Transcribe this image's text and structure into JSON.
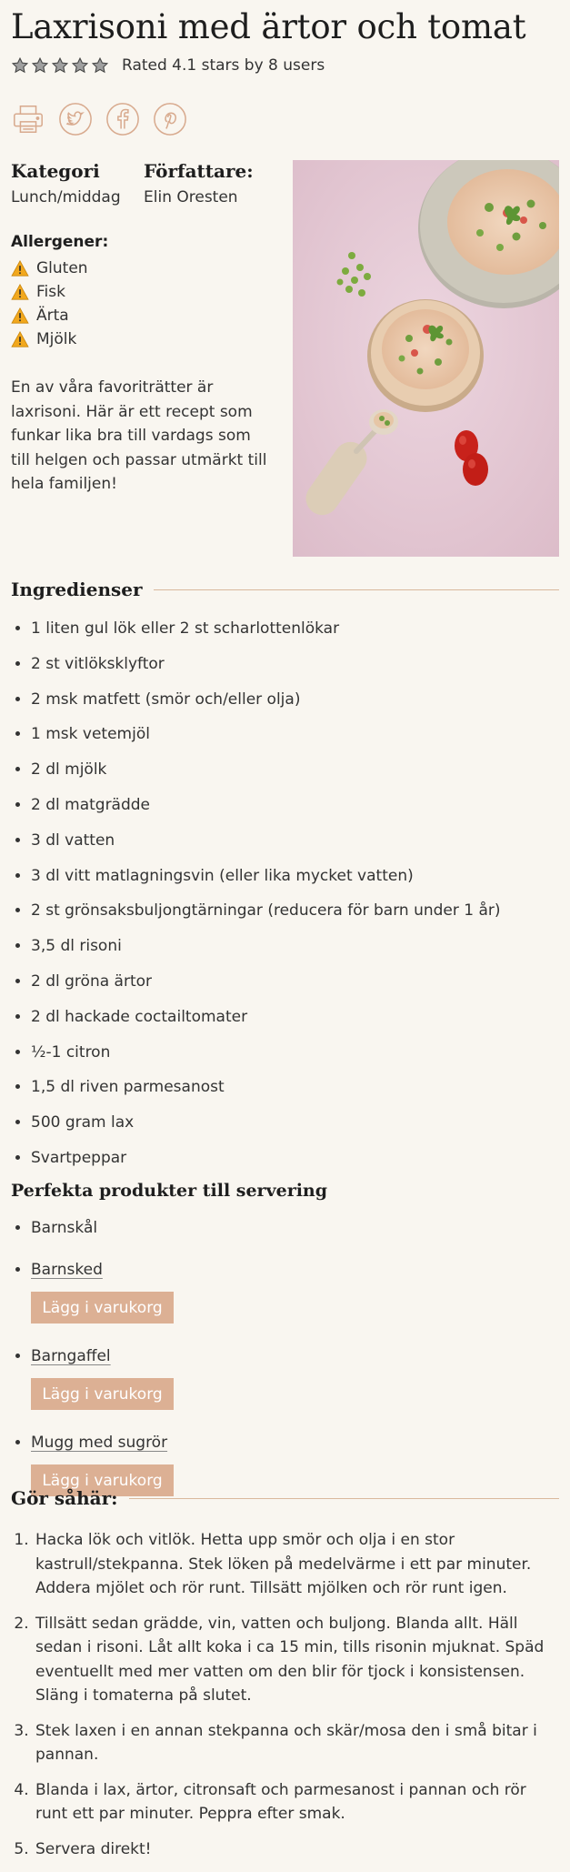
{
  "recipe": {
    "title": "Laxrisoni med ärtor och tomat",
    "rating_text": "Rated 4.1 stars by 8 users",
    "rating": {
      "stars_filled": 4.1,
      "stars_total": 5
    },
    "category_label": "Kategori",
    "category_value": "Lunch/middag",
    "author_label": "Författare:",
    "author_value": "Elin Oresten",
    "allergens_title": "Allergener:",
    "allergens": [
      "Gluten",
      "Fisk",
      "Ärta",
      "Mjölk"
    ],
    "description": "En av våra favoriträtter är laxrisoni. Här är ett recept som funkar lika bra till vardags som till helgen och passar utmärkt till hela familjen!"
  },
  "share_icons": [
    "print-icon",
    "twitter-icon",
    "facebook-icon",
    "pinterest-icon"
  ],
  "ingredients_title": "Ingredienser",
  "ingredients": [
    "1 liten gul lök eller 2 st scharlottenlökar",
    "2 st vitlöksklyftor",
    "2 msk matfett (smör och/eller olja)",
    "1 msk vetemjöl",
    "2 dl mjölk",
    "2 dl matgrädde",
    "3 dl vatten",
    "3 dl vitt matlagningsvin (eller lika mycket vatten)",
    "2 st grönsaksbuljongtärningar (reducera för barn under 1 år)",
    "3,5 dl risoni",
    "2 dl gröna ärtor",
    "2 dl hackade coctailtomater",
    "½-1 citron",
    "1,5 dl riven parmesanost",
    "500 gram lax",
    "Svartpeppar"
  ],
  "products_title": "Perfekta produkter till servering",
  "products": [
    {
      "name": "Barnskål"
    },
    {
      "name": "Barnsked",
      "button": "Lägg i varukorg"
    },
    {
      "name": "Barngaffel",
      "button": "Lägg i varukorg"
    },
    {
      "name": "Mugg med sugrör",
      "button": "Lägg i varukorg"
    }
  ],
  "steps_title": "Gör såhär:",
  "steps": [
    "Hacka lök och vitlök. Hetta upp smör och olja i en stor kastrull/stekpanna. Stek löken på medelvärme i ett par minuter. Addera mjölet och rör runt. Tillsätt mjölken och rör runt igen.",
    "Tillsätt sedan grädde, vin, vatten och buljong. Blanda allt. Häll sedan i risoni. Låt allt koka i ca 15 min, tills risonin mjuknat. Späd eventuellt med mer vatten om den blir för tjock i konsistensen. Släng i tomaterna på slutet.",
    "Stek laxen i en annan stekpanna och skär/mosa den i små bitar i pannan.",
    "Blanda i lax, ärtor, citronsaft och parmesanost i pannan och rör runt ett par minuter. Peppra efter smak.",
    "Servera direkt!"
  ],
  "colors": {
    "background": "#f9f6f0",
    "accent": "#dcb094",
    "icon_stroke": "#d8aa8e",
    "rule": "#d9b89c"
  }
}
